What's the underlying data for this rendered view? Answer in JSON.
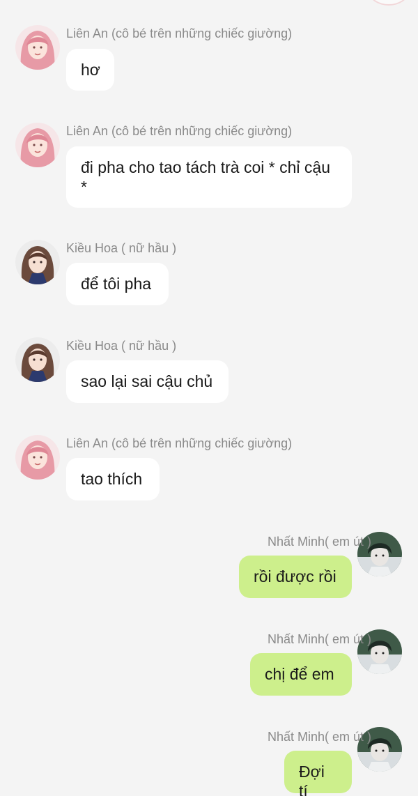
{
  "messages": [
    {
      "id": "m1",
      "side": "left",
      "avatar": "lien-an-avatar",
      "sender": "Liên An (cô bé trên những chiếc giường)",
      "text": "hơ"
    },
    {
      "id": "m2",
      "side": "left",
      "avatar": "lien-an-avatar",
      "sender": "Liên An (cô bé trên những chiếc giường)",
      "text": "đi pha cho tao tách trà coi * chỉ cậu *"
    },
    {
      "id": "m3",
      "side": "left",
      "avatar": "kieu-hoa-avatar",
      "sender": "Kiều Hoa ( nữ hầu )",
      "text": "để tôi pha"
    },
    {
      "id": "m4",
      "side": "left",
      "avatar": "kieu-hoa-avatar",
      "sender": "Kiều Hoa ( nữ hầu )",
      "text": "sao lại sai cậu chủ"
    },
    {
      "id": "m5",
      "side": "left",
      "avatar": "lien-an-avatar",
      "sender": "Liên An (cô bé trên những chiếc giường)",
      "text": "tao thích"
    },
    {
      "id": "m6",
      "side": "right",
      "avatar": "nhat-minh-avatar",
      "sender": "Nhất Minh( em út )",
      "text": "rồi được rồi"
    },
    {
      "id": "m7",
      "side": "right",
      "avatar": "nhat-minh-avatar",
      "sender": "Nhất Minh( em út )",
      "text": "chị để em"
    },
    {
      "id": "m8",
      "side": "right",
      "avatar": "nhat-minh-avatar",
      "sender": "Nhất Minh( em út )",
      "text": "Đợi tí"
    }
  ],
  "colors": {
    "background": "#f4f4f4",
    "incoming_bubble": "#ffffff",
    "outgoing_bubble": "#cdef8c",
    "sender_name": "#8a8a8a"
  }
}
